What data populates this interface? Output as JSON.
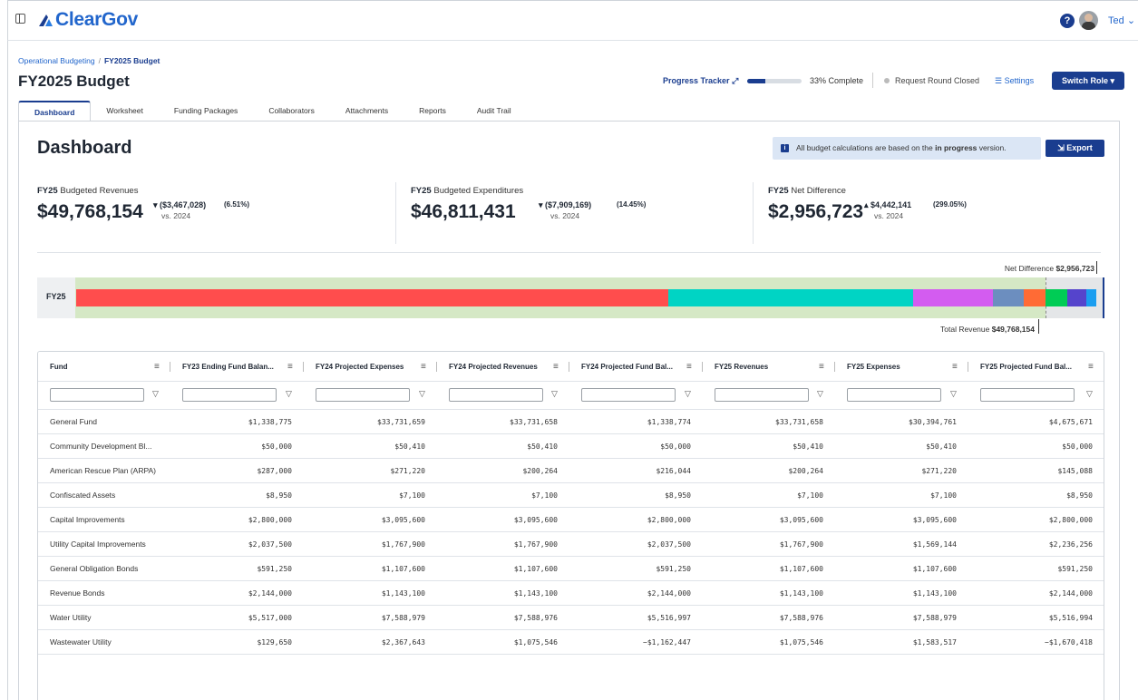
{
  "app": {
    "logo_text": "ClearGov",
    "user_name": "Ted",
    "help_label": "?"
  },
  "breadcrumb": {
    "parent": "Operational Budgeting",
    "separator": "/",
    "current": "FY2025 Budget"
  },
  "page": {
    "title": "FY2025 Budget"
  },
  "progress": {
    "label": "Progress Tracker",
    "percent": 33,
    "text": "33% Complete"
  },
  "status": {
    "round": "Request Round Closed",
    "settings": "Settings",
    "switch_role": "Switch Role ▾"
  },
  "tabs": [
    "Dashboard",
    "Worksheet",
    "Funding Packages",
    "Collaborators",
    "Attachments",
    "Reports",
    "Audit Trail"
  ],
  "dashboard": {
    "title": "Dashboard",
    "info_pre": "All budget calculations are based on the ",
    "info_bold": "in progress",
    "info_post": " version.",
    "export": "Export"
  },
  "metrics": [
    {
      "prefix": "FY25",
      "label": " Budgeted Revenues",
      "value": "$49,768,154",
      "arrow": "▾",
      "change": "($3,467,028)",
      "vs": "vs. 2024",
      "pct": "(6.51%)"
    },
    {
      "prefix": "FY25",
      "label": " Budgeted Expenditures",
      "value": "$46,811,431",
      "arrow": "▾",
      "change": "($7,909,169)",
      "vs": "vs. 2024",
      "pct": "(14.45%)"
    },
    {
      "prefix": "FY25",
      "label": " Net Difference",
      "value": "$2,956,723",
      "arrow": "▴",
      "change": "$4,442,141",
      "vs": "vs. 2024",
      "pct": "(299.05%)"
    }
  ],
  "bar": {
    "label": "FY25",
    "net_label": "Net Difference ",
    "net_value": "$2,956,723",
    "total_label": "Total Revenue ",
    "total_value": "$49,768,154",
    "segment_colors": [
      "#ff4d4d",
      "#00d4c4",
      "#d35cf0",
      "#6c8ebf",
      "#ff6b35",
      "#00cc55",
      "#5544cc",
      "#1a9ef0"
    ],
    "segment_values": [
      30394761,
      12554760,
      4091143,
      1569144,
      1107600,
      1100000,
      1000000,
      500000
    ]
  },
  "grid": {
    "columns": [
      "Fund",
      "FY23 Ending Fund Balan...",
      "FY24 Projected Expenses",
      "FY24 Projected Revenues",
      "FY24 Projected Fund Bal...",
      "FY25 Revenues",
      "FY25 Expenses",
      "FY25 Projected Fund Bal..."
    ],
    "rows": [
      [
        "General Fund",
        "$1,338,775",
        "$33,731,659",
        "$33,731,658",
        "$1,338,774",
        "$33,731,658",
        "$30,394,761",
        "$4,675,671"
      ],
      [
        "Community Development Bl...",
        "$50,000",
        "$50,410",
        "$50,410",
        "$50,000",
        "$50,410",
        "$50,410",
        "$50,000"
      ],
      [
        "American Rescue Plan (ARPA)",
        "$287,000",
        "$271,220",
        "$200,264",
        "$216,044",
        "$200,264",
        "$271,220",
        "$145,088"
      ],
      [
        "Confiscated Assets",
        "$8,950",
        "$7,100",
        "$7,100",
        "$8,950",
        "$7,100",
        "$7,100",
        "$8,950"
      ],
      [
        "Capital Improvements",
        "$2,800,000",
        "$3,095,600",
        "$3,095,600",
        "$2,800,000",
        "$3,095,600",
        "$3,095,600",
        "$2,800,000"
      ],
      [
        "Utility Capital Improvements",
        "$2,037,500",
        "$1,767,900",
        "$1,767,900",
        "$2,037,500",
        "$1,767,900",
        "$1,569,144",
        "$2,236,256"
      ],
      [
        "General Obligation Bonds",
        "$591,250",
        "$1,107,600",
        "$1,107,600",
        "$591,250",
        "$1,107,600",
        "$1,107,600",
        "$591,250"
      ],
      [
        "Revenue Bonds",
        "$2,144,000",
        "$1,143,100",
        "$1,143,100",
        "$2,144,000",
        "$1,143,100",
        "$1,143,100",
        "$2,144,000"
      ],
      [
        "Water Utility",
        "$5,517,000",
        "$7,588,979",
        "$7,588,976",
        "$5,516,997",
        "$7,588,976",
        "$7,588,979",
        "$5,516,994"
      ],
      [
        "Wastewater Utility",
        "$129,650",
        "$2,367,643",
        "$1,075,546",
        "−$1,162,447",
        "$1,075,546",
        "$1,583,517",
        "−$1,670,418"
      ]
    ]
  }
}
